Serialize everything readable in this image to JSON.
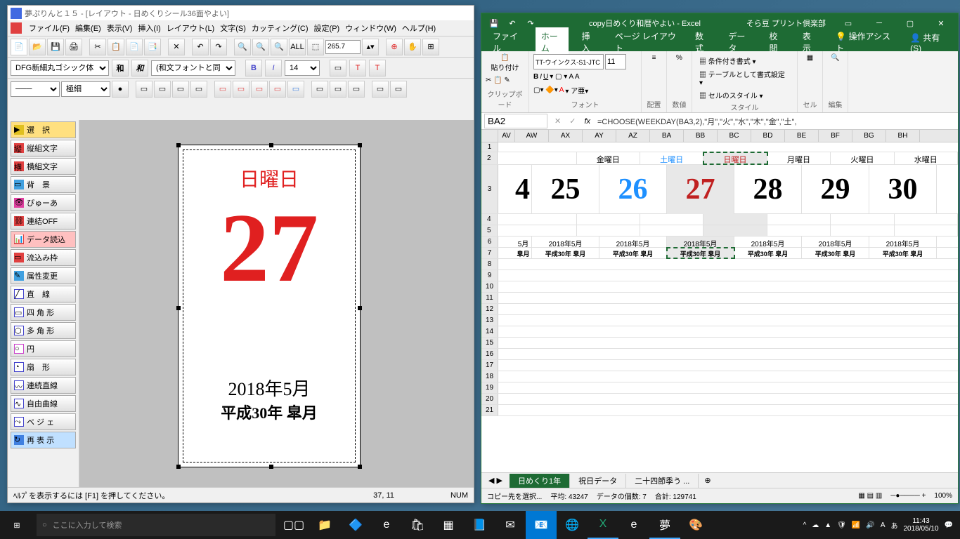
{
  "leftApp": {
    "title": "夢ぷりんと１５ - [レイアウト - 日めくりシール36面やよい]",
    "menu": [
      "ファイル(F)",
      "編集(E)",
      "表示(V)",
      "挿入(I)",
      "レイアウト(L)",
      "文字(S)",
      "カッティング(C)",
      "設定(P)",
      "ウィンドウ(W)",
      "ヘルプ(H)"
    ],
    "zoom": "265.7",
    "font": "DFG新細丸ゴシック体",
    "fontMode": "(和文フォントと同じ)",
    "fontSize": "14",
    "lineStyle": "極細",
    "sidebar": [
      "選　択",
      "縦組文字",
      "横組文字",
      "背　景",
      "ぴゅーあ",
      "連結OFF",
      "データ読込",
      "流込み枠",
      "属性変更",
      "直　線",
      "四 角 形",
      "多 角 形",
      "円",
      "扇　形",
      "連続直線",
      "自由曲線",
      "ベ ジ ェ",
      "再 表 示"
    ],
    "canvas": {
      "day": "日曜日",
      "num": "27",
      "ym": "2018年5月",
      "era": "平成30年 皐月"
    },
    "status1": "ﾍﾙﾌﾟを表示するには [F1] を押してください。",
    "status2": "37, 11",
    "status3": "NUM"
  },
  "excel": {
    "title": "copy日めくり和暦やよい - Excel",
    "user": "そら豆 プリント倶楽部",
    "tabs": [
      "ファイル",
      "ホーム",
      "挿入",
      "ページ レイアウト",
      "数式",
      "データ",
      "校閲",
      "表示"
    ],
    "tell": "操作アシスト",
    "share": "共有(S)",
    "ribbon": {
      "clipboard": "クリップボード",
      "paste": "貼り付け",
      "font": "フォント",
      "fontName": "TT-ウインクス-S1-JTC",
      "fontSize": "11",
      "align": "配置",
      "number": "数値",
      "styles": "スタイル",
      "condFmt": "条件付き書式",
      "tableFmt": "テーブルとして書式設定",
      "cellStyle": "セルのスタイル",
      "cells": "セル",
      "editing": "編集"
    },
    "nameBox": "BA2",
    "formula": "=CHOOSE(WEEKDAY(BA3,2),\"月\",\"火\",\"水\",\"木\",\"金\",\"土\",",
    "cols": [
      "AV",
      "AW",
      "AX",
      "AY",
      "AZ",
      "BA",
      "BB",
      "BC",
      "BD",
      "BE",
      "BF",
      "BG",
      "BH"
    ],
    "days": [
      {
        "label": "",
        "num": "4",
        "color": "#000"
      },
      {
        "label": "金曜日",
        "num": "25",
        "color": "#000"
      },
      {
        "label": "土曜日",
        "num": "26",
        "color": "#1e90ff"
      },
      {
        "label": "日曜日",
        "num": "27",
        "color": "#c02020",
        "sel": true
      },
      {
        "label": "月曜日",
        "num": "28",
        "color": "#000"
      },
      {
        "label": "火曜日",
        "num": "29",
        "color": "#000"
      },
      {
        "label": "水曜日",
        "num": "30",
        "color": "#000"
      }
    ],
    "ym": "2018年5月",
    "ymPartial": "5月",
    "era": "平成30年 皐月",
    "eraPartial": "皐月",
    "sheets": [
      "日めくり1年",
      "祝日データ",
      "二十四節季う ..."
    ],
    "statusMode": "コピー先を選択...",
    "statusAvg": "平均: 43247",
    "statusCount": "データの個数: 7",
    "statusSum": "合計: 129741",
    "statusZoom": "100%"
  },
  "taskbar": {
    "search": "ここに入力して検索",
    "time": "11:43",
    "date": "2018/05/10"
  },
  "chart_data": null
}
